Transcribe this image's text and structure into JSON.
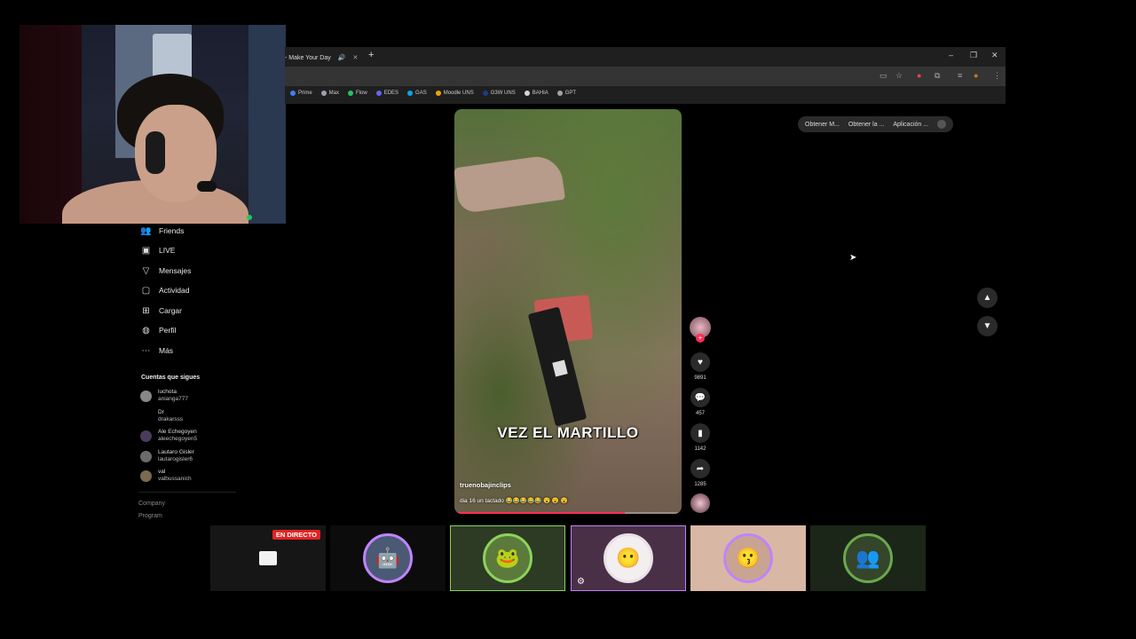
{
  "browser": {
    "tab_title": "- Make Your Day",
    "new_tab": "+",
    "win_min": "–",
    "win_max": "❐",
    "win_close": "✕",
    "bookmarks": [
      {
        "label": "Prime",
        "color": "#3b82f6"
      },
      {
        "label": "Max",
        "color": "#9ca3af"
      },
      {
        "label": "Flow",
        "color": "#22c55e"
      },
      {
        "label": "EDES",
        "color": "#6366f1"
      },
      {
        "label": "GAS",
        "color": "#0ea5e9"
      },
      {
        "label": "Moodle UNS",
        "color": "#f59e0b"
      },
      {
        "label": "G3W UNS",
        "color": "#1e3a8a"
      },
      {
        "label": "BAHIA",
        "color": "#d1d5db"
      },
      {
        "label": "GPT",
        "color": "#9ca3af"
      }
    ]
  },
  "tiktok": {
    "ext": {
      "obtener_m": "Obtener M...",
      "obtener_la": "Obtener la ...",
      "aplicacion": "Aplicación ..."
    },
    "sidebar": {
      "nav": [
        {
          "label": "Friends",
          "icon": "friends-icon"
        },
        {
          "label": "LIVE",
          "icon": "live-icon"
        },
        {
          "label": "Mensajes",
          "icon": "messages-icon"
        },
        {
          "label": "Actividad",
          "icon": "activity-icon"
        },
        {
          "label": "Cargar",
          "icon": "upload-icon"
        },
        {
          "label": "Perfil",
          "icon": "profile-icon"
        },
        {
          "label": "Más",
          "icon": "more-icon"
        }
      ],
      "following_title": "Cuentas que sigues",
      "accounts": [
        {
          "name": "luchota",
          "user": "anianga777"
        },
        {
          "name": "Dr",
          "user": "drakarsss"
        },
        {
          "name": "Ale Echegoyen",
          "user": "aleechegoyen5"
        },
        {
          "name": "Lautaro Gisler",
          "user": "lautarogisler6"
        },
        {
          "name": "val",
          "user": "valbussanich"
        }
      ],
      "footer": {
        "company": "Company",
        "program": "Program"
      }
    },
    "video": {
      "caption": "VEZ EL MARTILLO",
      "username": "truenobajinclips",
      "description": "dia 16 un tactado 😂😂😂😂😂 😮 😮 😮",
      "progress": 0.75
    },
    "actions": {
      "likes": "9891",
      "comments": "457",
      "saves": "1142",
      "shares": "1285"
    }
  },
  "overlay": {
    "live_badge": "EN DIRECTO"
  }
}
